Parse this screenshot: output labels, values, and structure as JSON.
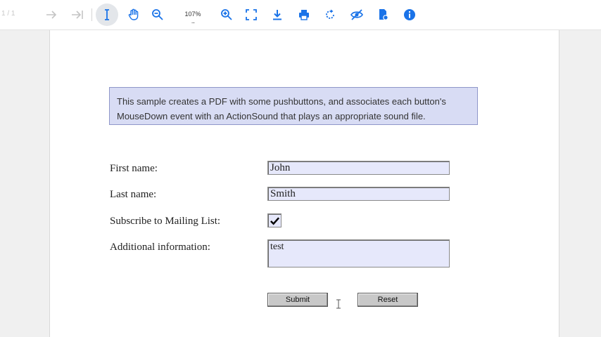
{
  "toolbar": {
    "page_count": "1 / 1",
    "zoom": "107%",
    "zoom_menu": "...",
    "tools": [
      "navigate-next-icon",
      "navigate-last-icon",
      "text-select-icon",
      "pan-icon",
      "zoom-out-icon",
      "zoom-in-icon",
      "fit-page-icon",
      "download-icon",
      "print-icon",
      "rotate-icon",
      "hide-annotations-icon",
      "form-fields-icon",
      "info-icon"
    ],
    "accent_color": "#1a73e8"
  },
  "document": {
    "description_line1": "This sample creates a PDF with some pushbuttons, and associates each button's",
    "description_line2": "MouseDown event with an ActionSound that plays an appropriate sound file.",
    "fields": {
      "first_name_label": "First name:",
      "first_name_value": "John",
      "last_name_label": "Last name:",
      "last_name_value": "Smith",
      "subscribe_label": "Subscribe to Mailing List:",
      "subscribe_checked": true,
      "additional_label": "Additional information:",
      "additional_value": "test"
    },
    "buttons": {
      "submit": "Submit",
      "reset": "Reset"
    }
  }
}
